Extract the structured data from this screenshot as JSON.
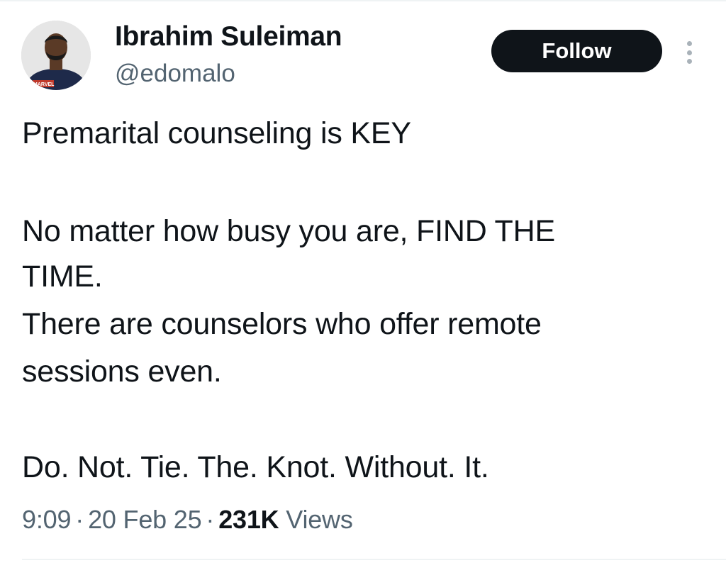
{
  "author": {
    "name": "Ibrahim Suleiman",
    "handle": "@edomalo",
    "avatar_shirt_text": "MARVEL"
  },
  "actions": {
    "follow_label": "Follow",
    "more_icon": "more-vertical-icon"
  },
  "tweet": {
    "lines": [
      "Premarital counseling is KEY",
      "No matter how busy you are, FIND THE",
      "TIME.",
      "There are counselors who offer remote",
      "sessions even.",
      "Do. Not. Tie. The. Knot. Without. It."
    ]
  },
  "meta": {
    "time": "9:09",
    "date": "20 Feb 25",
    "separator": "·",
    "views_count": "231K",
    "views_label": "Views"
  },
  "colors": {
    "text": "#0f1419",
    "secondary": "#536471",
    "follow_bg": "#0f1419",
    "follow_text": "#ffffff"
  }
}
